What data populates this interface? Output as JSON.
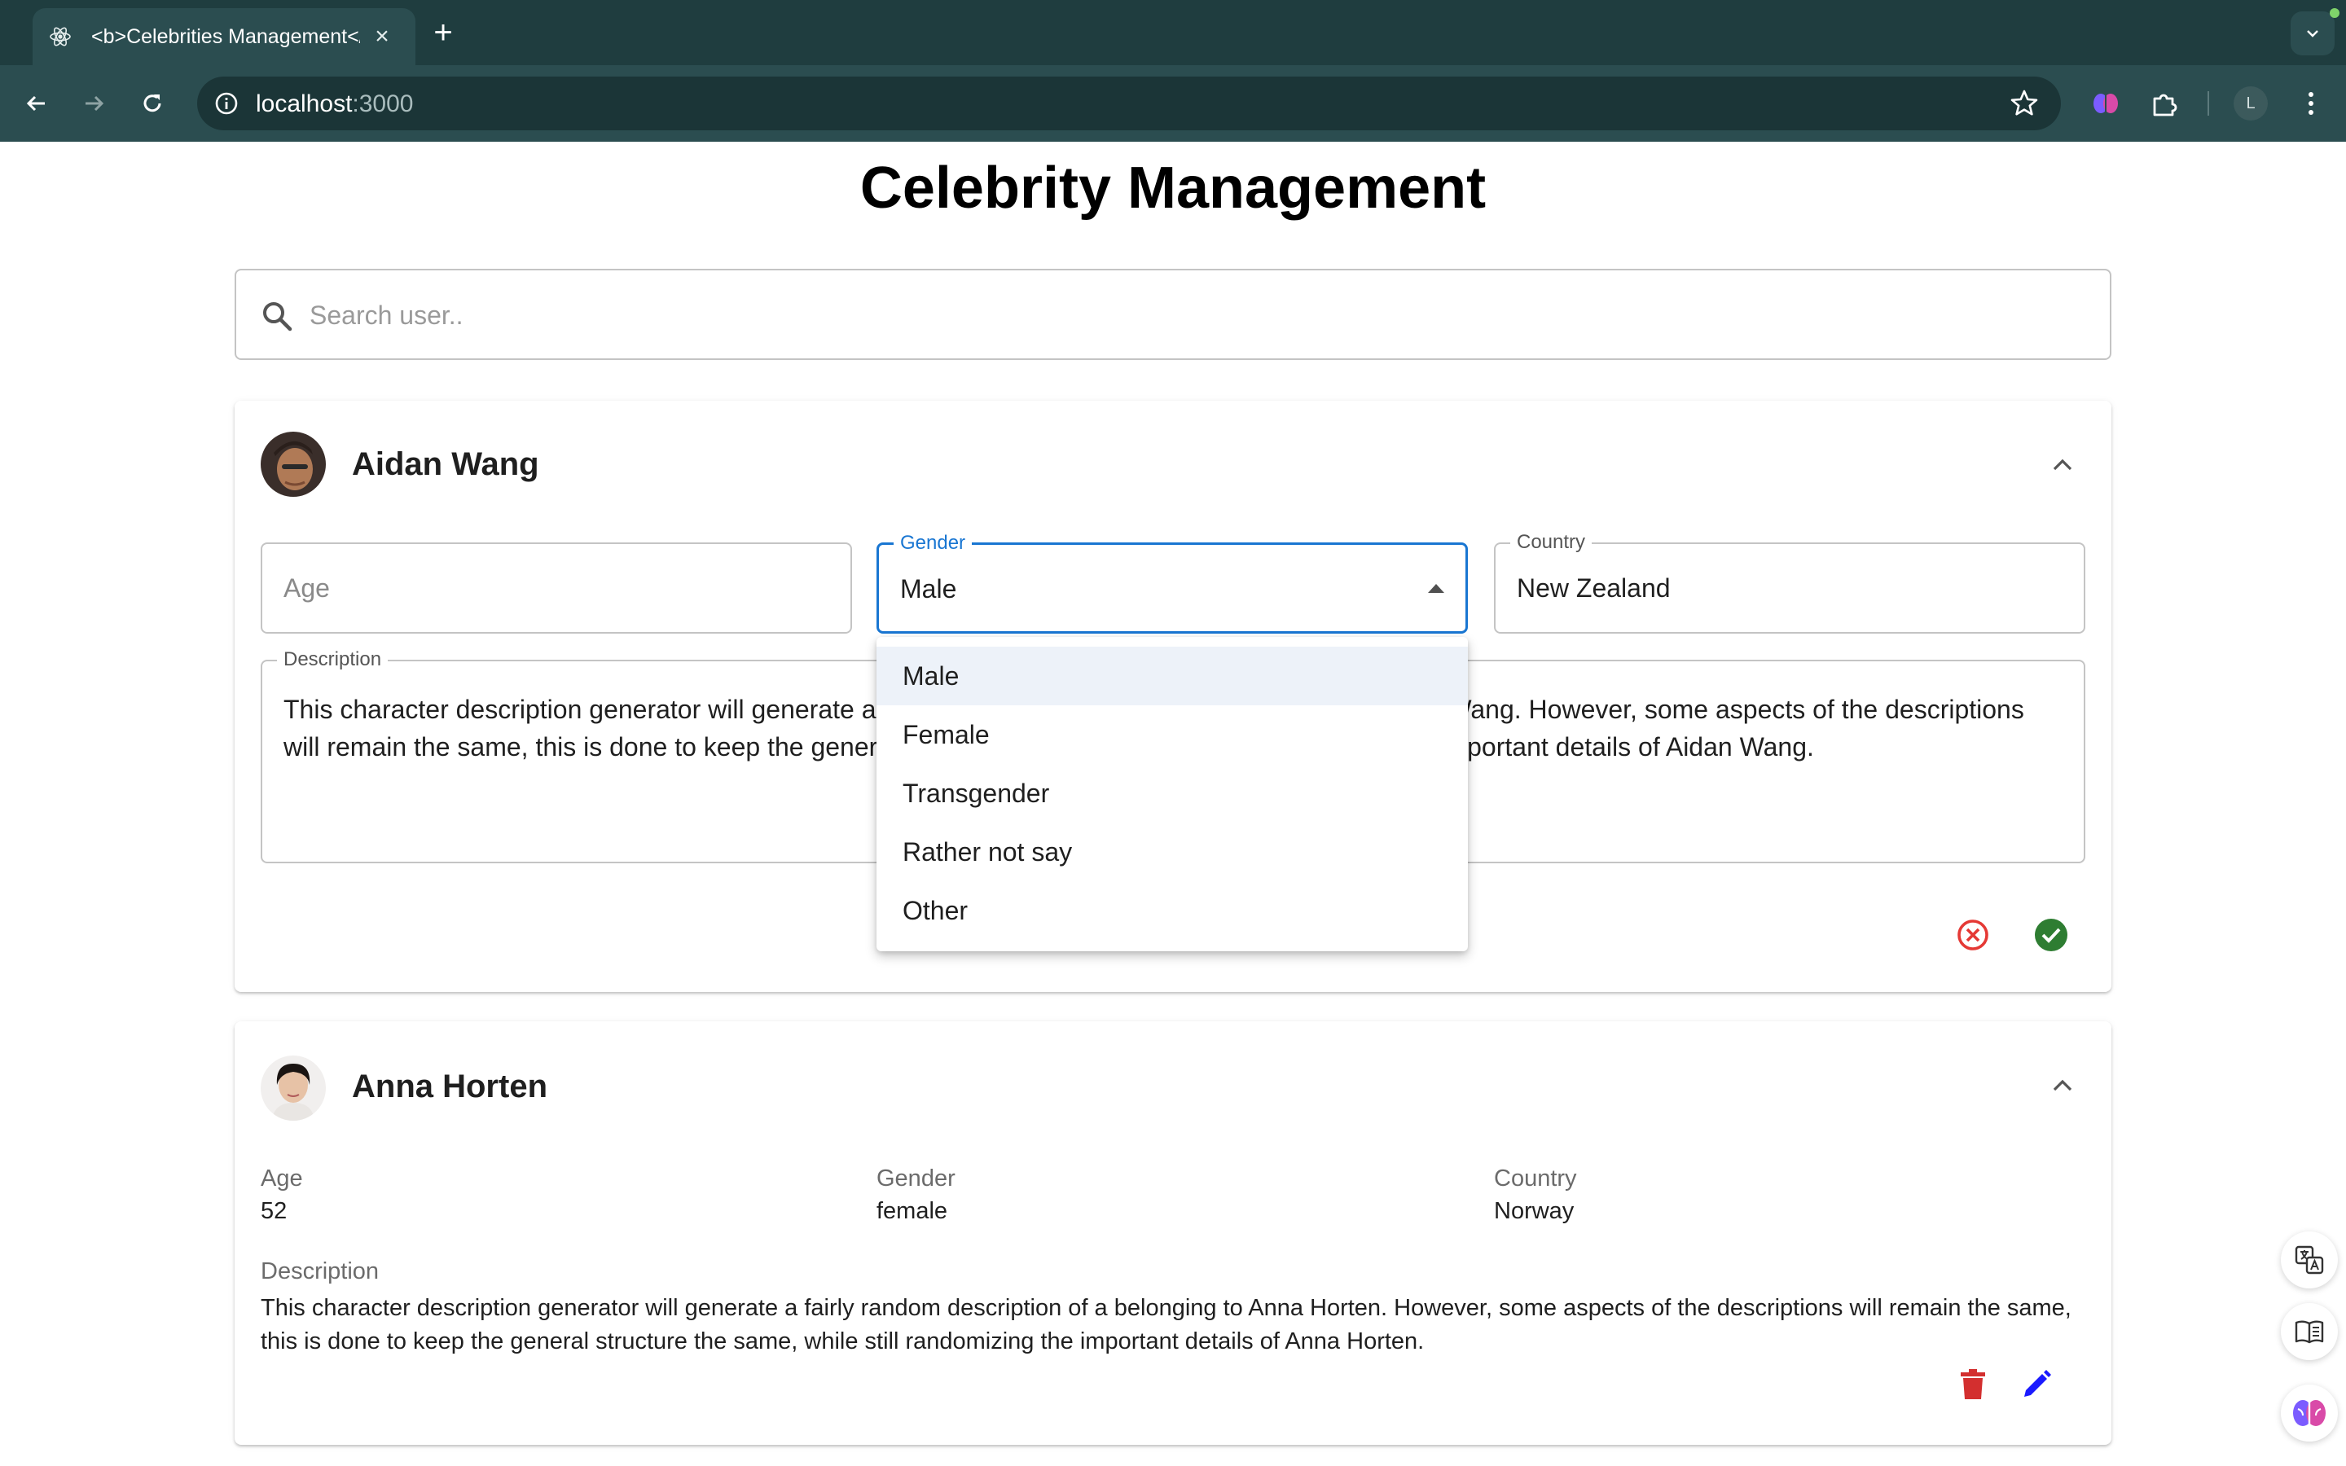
{
  "browser": {
    "tab_title": "<b>Celebrities Management</b>",
    "url_host": "localhost",
    "url_port": ":3000",
    "profile_initial": "L"
  },
  "page": {
    "title": "Celebrity Management",
    "search_placeholder": "Search user.."
  },
  "cards": [
    {
      "name": "Aidan Wang",
      "mode": "edit",
      "age_placeholder": "Age",
      "gender_label": "Gender",
      "gender_value": "Male",
      "country_label": "Country",
      "country_value": "New Zealand",
      "description_label": "Description",
      "description_value": "This character description generator will generate a fairly random description of a belonging to Aidan Wang. However, some aspects of the descriptions will remain the same, this is done to keep the general structure the same, while still randomizing the important details of Aidan Wang."
    },
    {
      "name": "Anna Horten",
      "mode": "view",
      "age_label": "Age",
      "age_value": "52",
      "gender_label": "Gender",
      "gender_value": "female",
      "country_label": "Country",
      "country_value": "Norway",
      "description_label": "Description",
      "description_value": "This character description generator will generate a fairly random description of a belonging to Anna Horten. However, some aspects of the descriptions will remain the same, this is done to keep the general structure the same, while still randomizing the important details of Anna Horten."
    }
  ],
  "gender_dropdown": {
    "options": [
      "Male",
      "Female",
      "Transgender",
      "Rather not say",
      "Other"
    ],
    "selected": "Male"
  },
  "colors": {
    "focus_blue": "#1976d2",
    "cancel_red": "#e53935",
    "confirm_green": "#2e7d32",
    "delete_red": "#d32f2f",
    "edit_blue": "#1a1aff",
    "chrome_dark": "#1f3d3f"
  }
}
